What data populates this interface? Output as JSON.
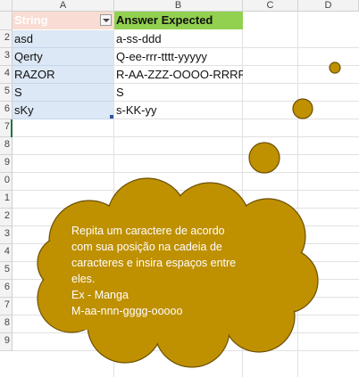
{
  "columns": [
    "A",
    "B",
    "C",
    "D"
  ],
  "rows": [
    "2",
    "3",
    "4",
    "5",
    "6",
    "7",
    "8",
    "9",
    "0",
    "1",
    "2",
    "3",
    "4",
    "5",
    "6",
    "7",
    "8",
    "9"
  ],
  "table": {
    "headers": [
      "String",
      "Answer Expected"
    ],
    "rows": [
      {
        "string": "asd",
        "answer": "a-ss-ddd"
      },
      {
        "string": "Qerty",
        "answer": "Q-ee-rrr-tttt-yyyyy"
      },
      {
        "string": "RAZOR",
        "answer": "R-AA-ZZZ-OOOO-RRRRR"
      },
      {
        "string": "S",
        "answer": "S"
      },
      {
        "string": "sKy",
        "answer": "s-KK-yy"
      }
    ]
  },
  "callout": {
    "lines": [
      "Repita um caractere de acordo",
      "com sua posição na cadeia de",
      "caracteres e insira espaços entre",
      "eles.",
      "Ex - Manga",
      "M-aa-nnn-gggg-ooooo"
    ],
    "fill_color": "#bf9000",
    "text_color": "#ffffff"
  },
  "colors": {
    "header_a_bg": "#f9dcd3",
    "header_b_bg": "#92d050",
    "row_a_bg": "#dce8f5"
  }
}
